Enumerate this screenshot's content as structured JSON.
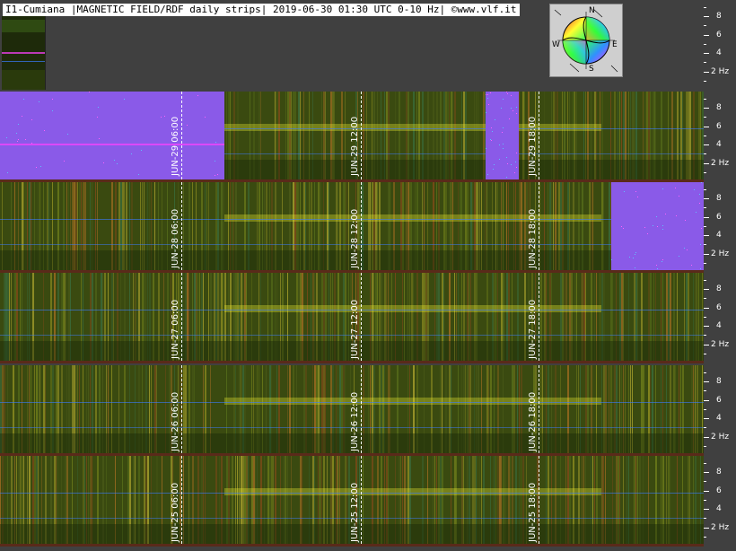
{
  "header": {
    "title": "I1-Cumiana |MAGNETIC FIELD/RDF daily strips| 2019-06-30 01:30 UTC 0-10 Hz| ©www.vlf.it"
  },
  "compass": {
    "n": "N",
    "s": "S",
    "e": "E",
    "w": "W"
  },
  "axis": {
    "ticks": [
      "8",
      "6",
      "4",
      "2 Hz"
    ]
  },
  "strips": [
    {
      "labels": [
        "JUN-29 06:00",
        "JUN-29 12:00",
        "JUN-29 18:00"
      ]
    },
    {
      "labels": [
        "JUN-28 06:00",
        "JUN-28 12:00",
        "JUN-28 18:00"
      ]
    },
    {
      "labels": [
        "JUN-27 06:00",
        "JUN-27 12:00",
        "JUN-27 18:00"
      ]
    },
    {
      "labels": [
        "JUN-26 06:00",
        "JUN-26 12:00",
        "JUN-26 18:00"
      ]
    },
    {
      "labels": [
        "JUN-25 06:00",
        "JUN-25 12:00",
        "JUN-25 18:00"
      ]
    }
  ],
  "colors": {
    "spectro_base": "#3a4a10",
    "blank_purple": "#8a5ae8",
    "band_yellow": "#e8e830",
    "line_blue": "#3b7cff",
    "line_magenta": "#ff40ff"
  }
}
